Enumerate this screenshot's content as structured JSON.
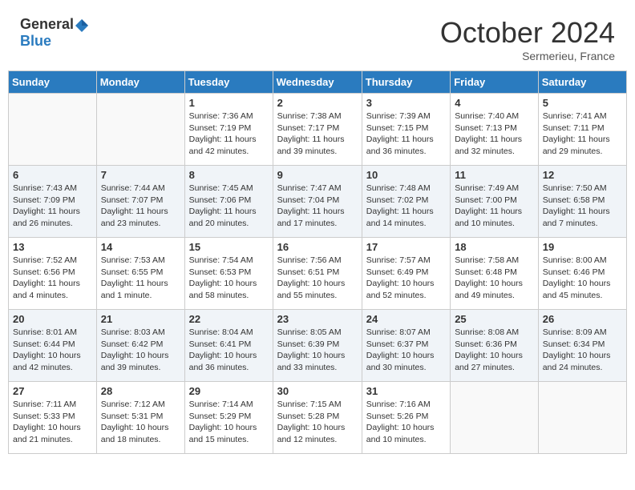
{
  "header": {
    "logo_general": "General",
    "logo_blue": "Blue",
    "month": "October 2024",
    "location": "Sermerieu, France"
  },
  "columns": [
    "Sunday",
    "Monday",
    "Tuesday",
    "Wednesday",
    "Thursday",
    "Friday",
    "Saturday"
  ],
  "weeks": [
    [
      {
        "day": "",
        "info": ""
      },
      {
        "day": "",
        "info": ""
      },
      {
        "day": "1",
        "info": "Sunrise: 7:36 AM\nSunset: 7:19 PM\nDaylight: 11 hours and 42 minutes."
      },
      {
        "day": "2",
        "info": "Sunrise: 7:38 AM\nSunset: 7:17 PM\nDaylight: 11 hours and 39 minutes."
      },
      {
        "day": "3",
        "info": "Sunrise: 7:39 AM\nSunset: 7:15 PM\nDaylight: 11 hours and 36 minutes."
      },
      {
        "day": "4",
        "info": "Sunrise: 7:40 AM\nSunset: 7:13 PM\nDaylight: 11 hours and 32 minutes."
      },
      {
        "day": "5",
        "info": "Sunrise: 7:41 AM\nSunset: 7:11 PM\nDaylight: 11 hours and 29 minutes."
      }
    ],
    [
      {
        "day": "6",
        "info": "Sunrise: 7:43 AM\nSunset: 7:09 PM\nDaylight: 11 hours and 26 minutes."
      },
      {
        "day": "7",
        "info": "Sunrise: 7:44 AM\nSunset: 7:07 PM\nDaylight: 11 hours and 23 minutes."
      },
      {
        "day": "8",
        "info": "Sunrise: 7:45 AM\nSunset: 7:06 PM\nDaylight: 11 hours and 20 minutes."
      },
      {
        "day": "9",
        "info": "Sunrise: 7:47 AM\nSunset: 7:04 PM\nDaylight: 11 hours and 17 minutes."
      },
      {
        "day": "10",
        "info": "Sunrise: 7:48 AM\nSunset: 7:02 PM\nDaylight: 11 hours and 14 minutes."
      },
      {
        "day": "11",
        "info": "Sunrise: 7:49 AM\nSunset: 7:00 PM\nDaylight: 11 hours and 10 minutes."
      },
      {
        "day": "12",
        "info": "Sunrise: 7:50 AM\nSunset: 6:58 PM\nDaylight: 11 hours and 7 minutes."
      }
    ],
    [
      {
        "day": "13",
        "info": "Sunrise: 7:52 AM\nSunset: 6:56 PM\nDaylight: 11 hours and 4 minutes."
      },
      {
        "day": "14",
        "info": "Sunrise: 7:53 AM\nSunset: 6:55 PM\nDaylight: 11 hours and 1 minute."
      },
      {
        "day": "15",
        "info": "Sunrise: 7:54 AM\nSunset: 6:53 PM\nDaylight: 10 hours and 58 minutes."
      },
      {
        "day": "16",
        "info": "Sunrise: 7:56 AM\nSunset: 6:51 PM\nDaylight: 10 hours and 55 minutes."
      },
      {
        "day": "17",
        "info": "Sunrise: 7:57 AM\nSunset: 6:49 PM\nDaylight: 10 hours and 52 minutes."
      },
      {
        "day": "18",
        "info": "Sunrise: 7:58 AM\nSunset: 6:48 PM\nDaylight: 10 hours and 49 minutes."
      },
      {
        "day": "19",
        "info": "Sunrise: 8:00 AM\nSunset: 6:46 PM\nDaylight: 10 hours and 45 minutes."
      }
    ],
    [
      {
        "day": "20",
        "info": "Sunrise: 8:01 AM\nSunset: 6:44 PM\nDaylight: 10 hours and 42 minutes."
      },
      {
        "day": "21",
        "info": "Sunrise: 8:03 AM\nSunset: 6:42 PM\nDaylight: 10 hours and 39 minutes."
      },
      {
        "day": "22",
        "info": "Sunrise: 8:04 AM\nSunset: 6:41 PM\nDaylight: 10 hours and 36 minutes."
      },
      {
        "day": "23",
        "info": "Sunrise: 8:05 AM\nSunset: 6:39 PM\nDaylight: 10 hours and 33 minutes."
      },
      {
        "day": "24",
        "info": "Sunrise: 8:07 AM\nSunset: 6:37 PM\nDaylight: 10 hours and 30 minutes."
      },
      {
        "day": "25",
        "info": "Sunrise: 8:08 AM\nSunset: 6:36 PM\nDaylight: 10 hours and 27 minutes."
      },
      {
        "day": "26",
        "info": "Sunrise: 8:09 AM\nSunset: 6:34 PM\nDaylight: 10 hours and 24 minutes."
      }
    ],
    [
      {
        "day": "27",
        "info": "Sunrise: 7:11 AM\nSunset: 5:33 PM\nDaylight: 10 hours and 21 minutes."
      },
      {
        "day": "28",
        "info": "Sunrise: 7:12 AM\nSunset: 5:31 PM\nDaylight: 10 hours and 18 minutes."
      },
      {
        "day": "29",
        "info": "Sunrise: 7:14 AM\nSunset: 5:29 PM\nDaylight: 10 hours and 15 minutes."
      },
      {
        "day": "30",
        "info": "Sunrise: 7:15 AM\nSunset: 5:28 PM\nDaylight: 10 hours and 12 minutes."
      },
      {
        "day": "31",
        "info": "Sunrise: 7:16 AM\nSunset: 5:26 PM\nDaylight: 10 hours and 10 minutes."
      },
      {
        "day": "",
        "info": ""
      },
      {
        "day": "",
        "info": ""
      }
    ]
  ]
}
